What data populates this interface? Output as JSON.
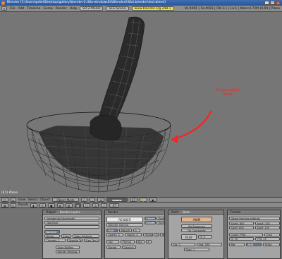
{
  "window": {
    "title": "Blender [C:\\Users\\pdiel\\Desktop\\gallery\\blender-2.48a-windows64\\Blender248a\\.blender\\test.blend]",
    "min": "_",
    "max": "□",
    "close": "×"
  },
  "info_header": {
    "menus": [
      "File",
      "Add",
      "Timeline",
      "Game",
      "Render",
      "Help"
    ],
    "layout": "SR:2-Model",
    "scene": "SCE:Scene",
    "url": "www.blender.org 248.1",
    "stats": "Ve:4091 | Fa:4093 | Ob:1-1 | La:1 | Mem:4.72M (0.00 | Plane"
  },
  "viewport": {
    "object_label": "(47) Plane",
    "annotation": "Single walled mesh",
    "annotation_color": "#ff2020"
  },
  "view3d_header": {
    "menus": [
      "View",
      "Select",
      "Object"
    ],
    "mode": "Object Mode",
    "layer": "47"
  },
  "buttons_header": {
    "panels_label": "Panels",
    "frame": "47"
  },
  "output_panel": {
    "tab": "Output",
    "tab2": "Render Layers",
    "path1": "//render\\4x4\\4net\\wall\\",
    "path2": "//backbuf",
    "path3": "",
    "backbuf": "Backbuf",
    "dither": "Dither",
    "edge": "Edge",
    "edge_settings": "Edge Settings",
    "save_buffers": "Save Buffers",
    "threads": "Threads: 2",
    "disable_tex": "Disable Tex",
    "free_tex": "Free Tex Images",
    "render_window": "Render Window"
  },
  "render_panel": {
    "tab": "Render",
    "render_button": "RENDER",
    "engine": "Blender Internal",
    "shadow": "Shadow",
    "envmap": "EnvMap",
    "ray": "Ray",
    "pano": "Pano",
    "osa": "OSA",
    "mblur": "MBLUR",
    "samples": "5",
    "xparts": "Xparts: 4",
    "yparts": "Yparts: 4",
    "fields": "Fields",
    "odd": "Odd",
    "x": "X",
    "border": "Border",
    "gamma": "Gamma",
    "sky": "Sky",
    "premul": "Premul",
    "key": "Key",
    "alpha": "8"
  },
  "anim_panel": {
    "tab": "Anim",
    "tab2": "Bake",
    "anim_button": "ANIM",
    "do_sequence": "Do Sequence",
    "do_composite": "Do Composite",
    "play": "PLAY",
    "rt": "rt: 0",
    "sta": "Sta: 1",
    "end": "End: 250",
    "step": "Step: 1"
  },
  "format_panel": {
    "tab": "Format",
    "preset": "Game framing settings",
    "sizex": "SizeX: 800",
    "sizey": "SizeY: 600",
    "aspx": "AspX: 100",
    "aspy": "AspY: 100",
    "codec": "Codec: PNG",
    "crop": "Crop",
    "bw": "BW",
    "rgb": "RGB",
    "rgba": "RGBA",
    "fps": "FPS: 25",
    "quality": "Q: 90"
  }
}
